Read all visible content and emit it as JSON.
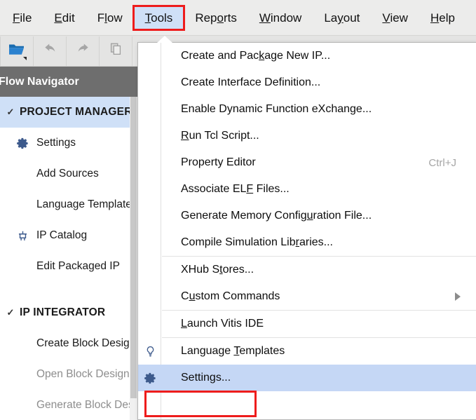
{
  "colors": {
    "annotation_red": "#ee1c1c",
    "menu_highlight_blue": "#c5d7f5",
    "sidebar_section_blue": "#cfe0f7",
    "flownav_header_gray": "#6e6e6e",
    "menubar_gray": "#ececeb",
    "icon_blue": "#3d5a8c",
    "shortcut_gray": "#a5a5a5",
    "disabled_gray": "#8d8d8d"
  },
  "menubar": {
    "items": [
      {
        "pre": "",
        "mnemonic": "F",
        "post": "ile",
        "name": "menu-file",
        "active": false
      },
      {
        "pre": "",
        "mnemonic": "E",
        "post": "dit",
        "name": "menu-edit",
        "active": false
      },
      {
        "pre": "F",
        "mnemonic": "l",
        "post": "ow",
        "name": "menu-flow",
        "active": false
      },
      {
        "pre": "",
        "mnemonic": "T",
        "post": "ools",
        "name": "menu-tools",
        "active": true
      },
      {
        "pre": "Rep",
        "mnemonic": "o",
        "post": "rts",
        "name": "menu-reports",
        "active": false
      },
      {
        "pre": "",
        "mnemonic": "W",
        "post": "indow",
        "name": "menu-window",
        "active": false
      },
      {
        "pre": "La",
        "mnemonic": "y",
        "post": "out",
        "name": "menu-layout",
        "active": false
      },
      {
        "pre": "",
        "mnemonic": "V",
        "post": "iew",
        "name": "menu-view",
        "active": false
      },
      {
        "pre": "",
        "mnemonic": "H",
        "post": "elp",
        "name": "menu-help",
        "active": false
      }
    ]
  },
  "toolbar": {
    "buttons": [
      {
        "icon": "open-folder-icon",
        "name": "open-project-button",
        "has_caret": true,
        "enabled": true
      },
      {
        "icon": "undo-arrow-icon",
        "name": "undo-button",
        "has_caret": false,
        "enabled": false
      },
      {
        "icon": "redo-arrow-icon",
        "name": "redo-button",
        "has_caret": false,
        "enabled": false
      },
      {
        "icon": "copy-icon",
        "name": "copy-button",
        "has_caret": false,
        "enabled": false
      }
    ]
  },
  "sidebar": {
    "header": "Flow Navigator",
    "chevron_glyph": "✓",
    "groups": [
      {
        "section_label": "PROJECT MANAGER",
        "section_name": "sidebar-section-project-manager",
        "highlighted": true,
        "expanded": true,
        "items": [
          {
            "label": "Settings",
            "icon": "gear-icon",
            "name": "sidebar-item-settings",
            "disabled": false
          },
          {
            "label": "Add Sources",
            "icon": "",
            "name": "sidebar-item-add-sources",
            "disabled": false
          },
          {
            "label": "Language Templates",
            "icon": "",
            "name": "sidebar-item-language-templates",
            "disabled": false
          },
          {
            "label": "IP Catalog",
            "icon": "ip-chip-icon",
            "name": "sidebar-item-ip-catalog",
            "disabled": false
          },
          {
            "label": "Edit Packaged IP",
            "icon": "",
            "name": "sidebar-item-edit-packaged-ip",
            "disabled": false
          }
        ]
      },
      {
        "section_label": "IP INTEGRATOR",
        "section_name": "sidebar-section-ip-integrator",
        "highlighted": false,
        "expanded": true,
        "items": [
          {
            "label": "Create Block Design",
            "icon": "",
            "name": "sidebar-item-create-block-design",
            "disabled": false
          },
          {
            "label": "Open Block Design",
            "icon": "",
            "name": "sidebar-item-open-block-design",
            "disabled": true
          },
          {
            "label": "Generate Block Design",
            "icon": "",
            "name": "sidebar-item-generate-block-design",
            "disabled": true
          }
        ]
      }
    ]
  },
  "tools_menu": {
    "open": true,
    "entries": [
      {
        "type": "item",
        "pre": "Create and Pac",
        "mnemonic": "k",
        "post": "age New IP...",
        "shortcut": "",
        "icon": "",
        "submenu": false,
        "selected": false,
        "name": "menu-item-create-and-package-new-ip"
      },
      {
        "type": "item",
        "pre": "Create Interface Definition...",
        "mnemonic": "",
        "post": "",
        "shortcut": "",
        "icon": "",
        "submenu": false,
        "selected": false,
        "name": "menu-item-create-interface-definition"
      },
      {
        "type": "item",
        "pre": "Enable Dynamic Function eXchange...",
        "mnemonic": "",
        "post": "",
        "shortcut": "",
        "icon": "",
        "submenu": false,
        "selected": false,
        "name": "menu-item-enable-dynamic-function-exchange"
      },
      {
        "type": "item",
        "pre": "",
        "mnemonic": "R",
        "post": "un Tcl Script...",
        "shortcut": "",
        "icon": "",
        "submenu": false,
        "selected": false,
        "name": "menu-item-run-tcl-script"
      },
      {
        "type": "item",
        "pre": "Property Editor",
        "mnemonic": "",
        "post": "",
        "shortcut": "Ctrl+J",
        "icon": "",
        "submenu": false,
        "selected": false,
        "name": "menu-item-property-editor"
      },
      {
        "type": "item",
        "pre": "Associate EL",
        "mnemonic": "F",
        "post": " Files...",
        "shortcut": "",
        "icon": "",
        "submenu": false,
        "selected": false,
        "name": "menu-item-associate-elf-files"
      },
      {
        "type": "item",
        "pre": "Generate Memory Config",
        "mnemonic": "u",
        "post": "ration File...",
        "shortcut": "",
        "icon": "",
        "submenu": false,
        "selected": false,
        "name": "menu-item-generate-memory-configuration-file"
      },
      {
        "type": "item",
        "pre": "Compile Simulation Lib",
        "mnemonic": "r",
        "post": "aries...",
        "shortcut": "",
        "icon": "",
        "submenu": false,
        "selected": false,
        "name": "menu-item-compile-simulation-libraries"
      },
      {
        "type": "separator",
        "name": "menu-separator-1"
      },
      {
        "type": "item",
        "pre": "XHub S",
        "mnemonic": "t",
        "post": "ores...",
        "shortcut": "",
        "icon": "",
        "submenu": false,
        "selected": false,
        "name": "menu-item-xhub-stores"
      },
      {
        "type": "item",
        "pre": "C",
        "mnemonic": "u",
        "post": "stom Commands",
        "shortcut": "",
        "icon": "",
        "submenu": true,
        "selected": false,
        "name": "menu-item-custom-commands"
      },
      {
        "type": "separator",
        "name": "menu-separator-2"
      },
      {
        "type": "item",
        "pre": "",
        "mnemonic": "L",
        "post": "aunch Vitis IDE",
        "shortcut": "",
        "icon": "",
        "submenu": false,
        "selected": false,
        "name": "menu-item-launch-vitis-ide"
      },
      {
        "type": "separator",
        "name": "menu-separator-3"
      },
      {
        "type": "item",
        "pre": "Language ",
        "mnemonic": "T",
        "post": "emplates",
        "shortcut": "",
        "icon": "lightbulb-icon",
        "submenu": false,
        "selected": false,
        "name": "menu-item-language-templates"
      },
      {
        "type": "item",
        "pre": "Settings...",
        "mnemonic": "",
        "post": "",
        "shortcut": "",
        "icon": "gear-icon",
        "submenu": false,
        "selected": true,
        "name": "menu-item-settings"
      }
    ]
  },
  "annotations": [
    {
      "target": "menu-tools",
      "name": "annotation-box-tools"
    },
    {
      "target": "menu-item-settings",
      "name": "annotation-box-settings"
    }
  ]
}
